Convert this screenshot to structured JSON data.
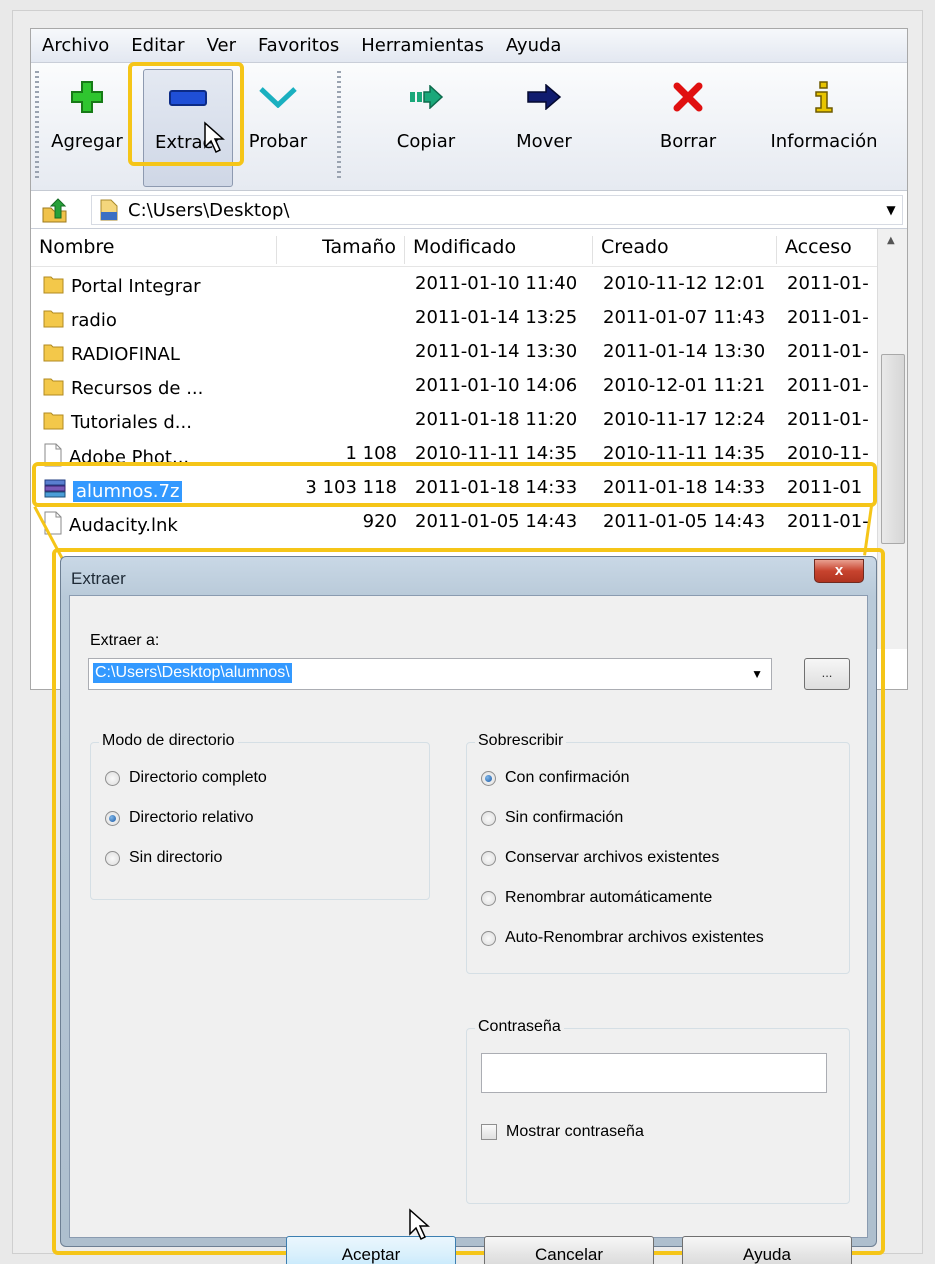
{
  "menu": [
    "Archivo",
    "Editar",
    "Ver",
    "Favoritos",
    "Herramientas",
    "Ayuda"
  ],
  "toolbar": {
    "add": "Agregar",
    "extract": "Extraer",
    "test": "Probar",
    "copy": "Copiar",
    "move": "Mover",
    "delete": "Borrar",
    "info": "Información"
  },
  "address": {
    "path": "C:\\Users\\Desktop\\"
  },
  "columns": {
    "name": "Nombre",
    "size": "Tamaño",
    "modified": "Modificado",
    "created": "Creado",
    "accessed": "Acceso"
  },
  "files": [
    {
      "name": "Portal Integrar",
      "type": "folder",
      "size": "",
      "modified": "2011-01-10 11:40",
      "created": "2010-11-12 12:01",
      "accessed": "2011-01-"
    },
    {
      "name": "radio",
      "type": "folder",
      "size": "",
      "modified": "2011-01-14 13:25",
      "created": "2011-01-07 11:43",
      "accessed": "2011-01-"
    },
    {
      "name": "RADIOFINAL",
      "type": "folder",
      "size": "",
      "modified": "2011-01-14 13:30",
      "created": "2011-01-14 13:30",
      "accessed": "2011-01-"
    },
    {
      "name": "Recursos de ...",
      "type": "folder",
      "size": "",
      "modified": "2011-01-10 14:06",
      "created": "2010-12-01 11:21",
      "accessed": "2011-01-"
    },
    {
      "name": "Tutoriales d...",
      "type": "folder",
      "size": "",
      "modified": "2011-01-18 11:20",
      "created": "2010-11-17 12:24",
      "accessed": "2011-01-"
    },
    {
      "name": "Adobe Phot...",
      "type": "file",
      "size": "1 108",
      "modified": "2010-11-11 14:35",
      "created": "2010-11-11 14:35",
      "accessed": "2010-11-"
    },
    {
      "name": "alumnos.7z",
      "type": "archive",
      "size": "3 103 118",
      "modified": "2011-01-18 14:33",
      "created": "2011-01-18 14:33",
      "accessed": "2011-01"
    },
    {
      "name": "Audacity.lnk",
      "type": "file",
      "size": "920",
      "modified": "2011-01-05 14:43",
      "created": "2011-01-05 14:43",
      "accessed": "2011-01-"
    }
  ],
  "dialog": {
    "title": "Extraer",
    "close": "x",
    "extract_to_label": "Extraer a:",
    "extract_to_value": "C:\\Users\\Desktop\\alumnos\\",
    "browse": "...",
    "dir_mode": {
      "title": "Modo de directorio",
      "options": [
        "Directorio completo",
        "Directorio relativo",
        "Sin directorio"
      ],
      "selected": "Directorio relativo"
    },
    "overwrite": {
      "title": "Sobrescribir",
      "options": [
        "Con confirmación",
        "Sin confirmación",
        "Conservar archivos existentes",
        "Renombrar automáticamente",
        "Auto-Renombrar archivos existentes"
      ],
      "selected": "Con confirmación"
    },
    "password": {
      "title": "Contraseña",
      "value": "",
      "show_label": "Mostrar contraseña",
      "show_checked": false
    },
    "buttons": {
      "ok": "Aceptar",
      "cancel": "Cancelar",
      "help": "Ayuda"
    }
  },
  "colors": {
    "highlight": "#f5c518",
    "selection": "#3399ff"
  }
}
